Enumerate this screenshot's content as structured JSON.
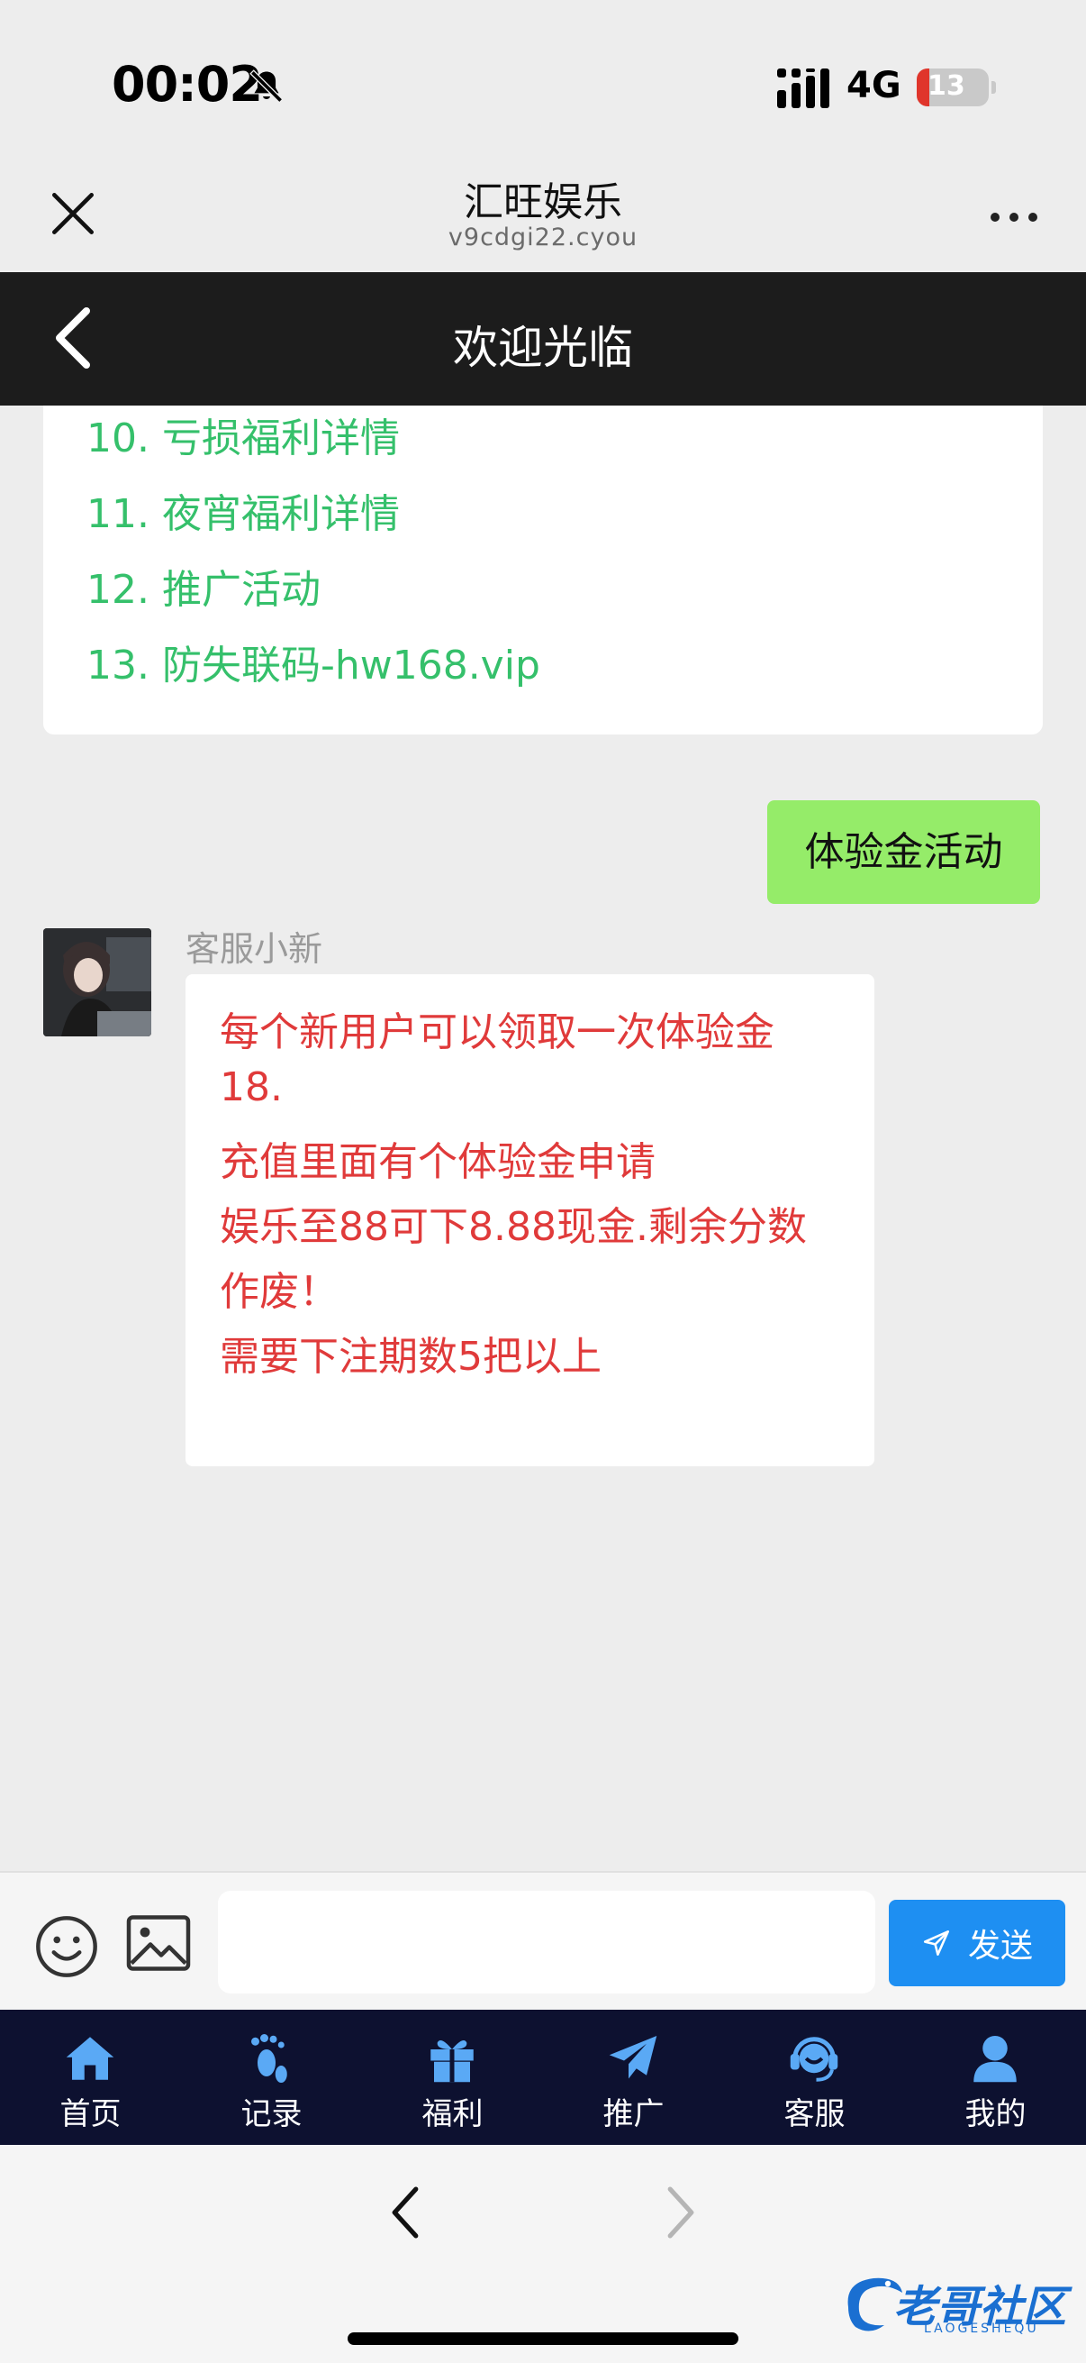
{
  "status_bar": {
    "time": "00:02",
    "network": "4G",
    "battery": "13"
  },
  "browser": {
    "title": "汇旺娱乐",
    "domain": "v9cdgi22.cyou"
  },
  "header": {
    "title": "欢迎光临"
  },
  "menu_items": [
    "10. 亏损福利详情",
    "11. 夜宵福利详情",
    "12. 推广活动",
    "13. 防失联码-hw168.vip"
  ],
  "chat": {
    "user_message": "体验金活动",
    "agent_name": "客服小新",
    "agent_message_lines": [
      "每个新用户可以领取一次体验金",
      "18.",
      "充值里面有个体验金申请",
      "娱乐至88可下8.88现金.剩余分数",
      "作废！",
      "需要下注期数5把以上"
    ]
  },
  "input": {
    "value": "",
    "placeholder": "",
    "send_label": "发送"
  },
  "tabs": [
    {
      "label": "首页",
      "icon": "home-icon"
    },
    {
      "label": "记录",
      "icon": "footprints-icon"
    },
    {
      "label": "福利",
      "icon": "gift-icon"
    },
    {
      "label": "推广",
      "icon": "paper-plane-icon"
    },
    {
      "label": "客服",
      "icon": "headset-icon"
    },
    {
      "label": "我的",
      "icon": "user-icon"
    }
  ],
  "watermark": {
    "text": "老哥社区",
    "sub": "LAOGESHEQU"
  },
  "colors": {
    "menu_link": "#35c06b",
    "user_bubble": "#95ec69",
    "agent_text": "#e03a3a",
    "send_button": "#1e8ff2",
    "tab_bar": "#0d1130",
    "app_header": "#1c1c1c"
  }
}
